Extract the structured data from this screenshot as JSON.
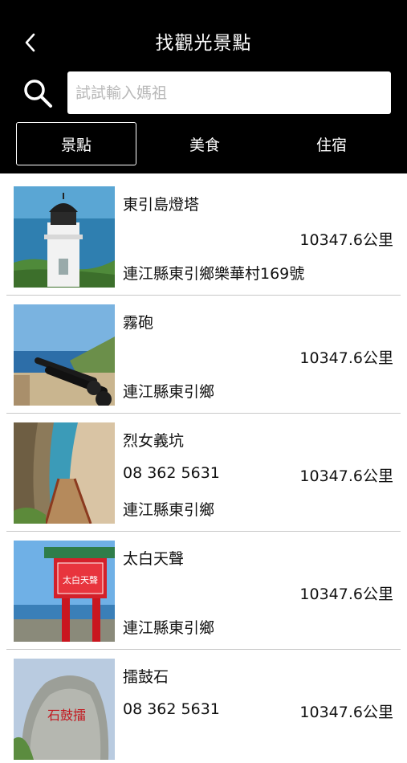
{
  "header": {
    "title": "找觀光景點",
    "back_icon": "chevron-left-icon"
  },
  "search": {
    "placeholder": "試試輸入媽祖",
    "value": "",
    "icon": "search-icon"
  },
  "tabs": [
    {
      "label": "景點",
      "active": true
    },
    {
      "label": "美食",
      "active": false
    },
    {
      "label": "住宿",
      "active": false
    }
  ],
  "items": [
    {
      "name": "東引島燈塔",
      "phone": "",
      "distance": "10347.6公里",
      "address": "連江縣東引鄉樂華村169號"
    },
    {
      "name": "霧砲",
      "phone": "",
      "distance": "10347.6公里",
      "address": "連江縣東引鄉"
    },
    {
      "name": "烈女義坑",
      "phone": "08 362 5631",
      "distance": "10347.6公里",
      "address": "連江縣東引鄉"
    },
    {
      "name": "太白天聲",
      "phone": "",
      "distance": "10347.6公里",
      "address": "連江縣東引鄉"
    },
    {
      "name": "擂鼓石",
      "phone": "08 362 5631",
      "distance": "10347.6公里",
      "address": ""
    }
  ],
  "photo_texts": {
    "sign": "太白天聲",
    "rock": "石鼓擂"
  },
  "colors": {
    "header_bg": "#000000",
    "page_bg": "#ffffff",
    "divider": "#c8c8c8"
  }
}
